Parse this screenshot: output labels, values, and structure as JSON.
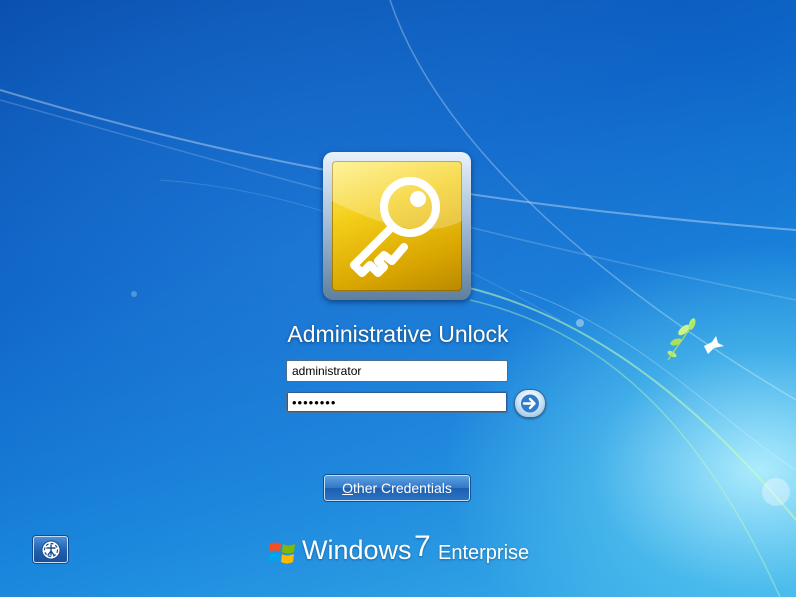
{
  "login": {
    "title": "Administrative Unlock",
    "username_value": "administrator",
    "password_value": "••••••••",
    "other_credentials_prefix": "O",
    "other_credentials_rest": "ther Credentials"
  },
  "brand": {
    "name": "Windows",
    "version": "7",
    "edition": "Enterprise"
  },
  "icons": {
    "user_tile": "key-icon",
    "submit": "arrow-right-icon",
    "ease_of_access": "ease-of-access-icon",
    "logo": "windows-flag-icon"
  },
  "colors": {
    "background": "#0d63c6",
    "tile_gold": "#f4cf1a",
    "button_blue": "#2f77c8"
  }
}
